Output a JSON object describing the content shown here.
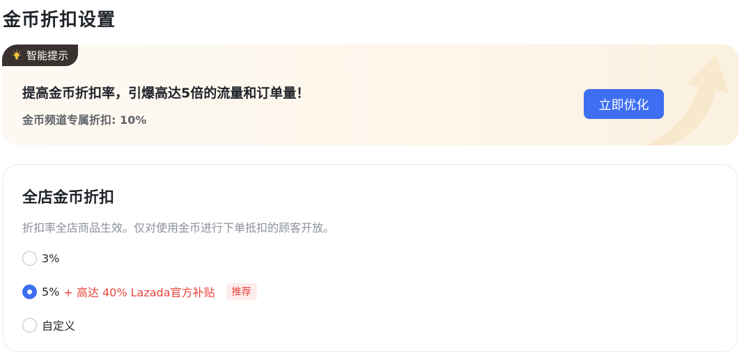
{
  "page": {
    "title": "金币折扣设置"
  },
  "tip": {
    "tag_label": "智能提示",
    "headline": "提高金币折扣率，引爆高达5倍的流量和订单量！",
    "subline": "金币频道专属折扣: 10%",
    "button_label": "立即优化",
    "accent_color": "#3e6ef2"
  },
  "discount": {
    "title": "全店金币折扣",
    "description": "折扣率全店商品生效。仅对使用金币进行下单抵扣的顾客开放。",
    "options": [
      {
        "label": "3%",
        "selected": false
      },
      {
        "label": "5%",
        "promo": "+ 高达 40% Lazada官方补贴",
        "badge": "推荐",
        "selected": true
      },
      {
        "label": "自定义",
        "selected": false
      }
    ]
  }
}
